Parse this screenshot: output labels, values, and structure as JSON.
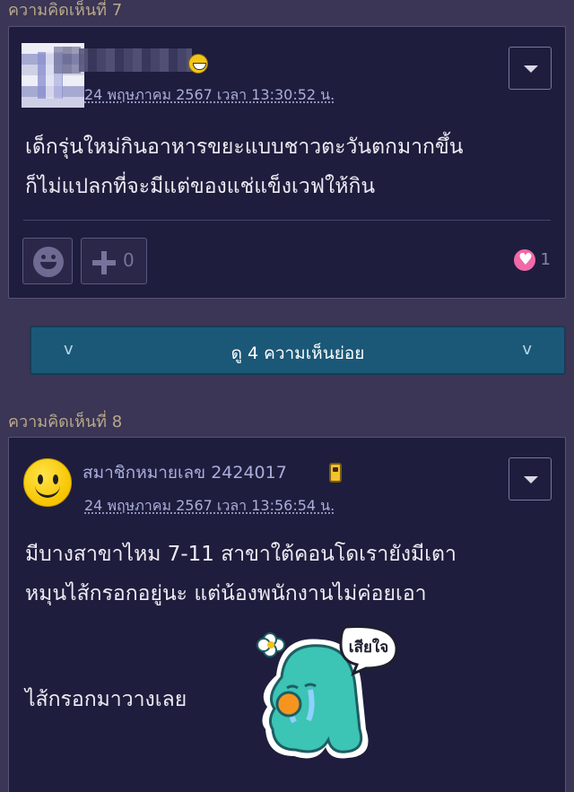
{
  "comment7": {
    "header": "ความคิดเห็นที่ 7",
    "timestamp": "24 พฤษภาคม 2567 เวลา 13:30:52 น.",
    "body": "เด็กรุ่นใหม่กินอาหารขยะแบบชาวตะวันตกมากขึ้น\nก็ไม่แปลกที่จะมีแต่ของแช่แข็งเวฟให้กิน",
    "plus_count": "0",
    "heart_count": "1"
  },
  "replies": {
    "label": "ดู 4 ความเห็นย่อย",
    "left_chevron": "v",
    "right_chevron": "v"
  },
  "comment8": {
    "header": "ความคิดเห็นที่ 8",
    "author": "สมาชิกหมายเลข 2424017",
    "timestamp": "24 พฤษภาคม 2567 เวลา 13:56:54 น.",
    "body_line1": "มีบางสาขาไหม 7-11 สาขาใต้คอนโดเรายังมีเตา",
    "body_line2": "หมุนไส้กรอกอยู่นะ แต่น้องพนักงานไม่ค่อยเอา",
    "body_line3": "ไส้กรอกมาวางเลย",
    "sticker_text": "เสียใจ"
  },
  "colors": {
    "background": "#3b3556",
    "card": "#1f1d3d",
    "link": "#a9aedb",
    "replies_bar": "#1b5877",
    "header_text": "#b9a98a"
  }
}
